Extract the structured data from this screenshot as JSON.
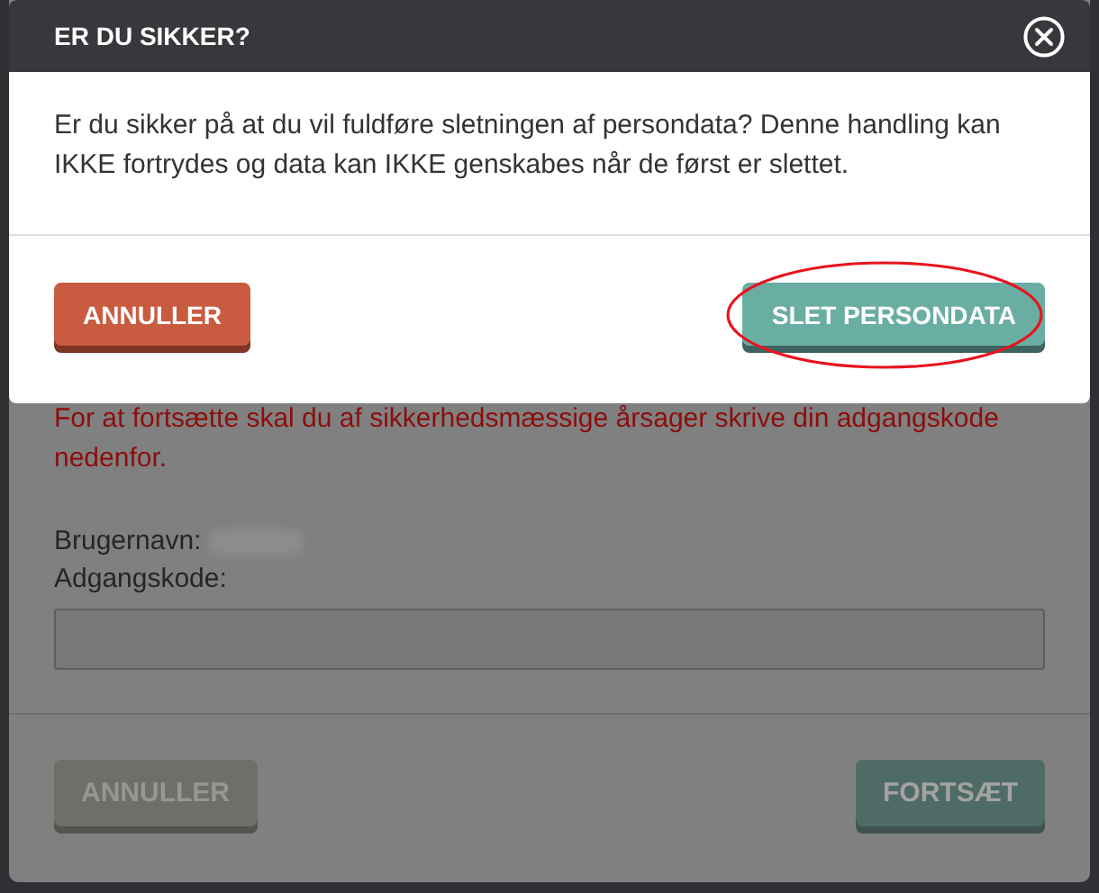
{
  "dialog": {
    "title": "ER DU SIKKER?",
    "message": "Er du sikker på at du vil fuldføre sletningen af persondata? Denne handling kan IKKE fortrydes og data kan IKKE genskabes når de først er slettet.",
    "buttons": [
      {
        "label": "ANNULLER",
        "kind": "cancel",
        "circled": false
      },
      {
        "label": "SLET PERSONDATA",
        "kind": "confirm",
        "circled": true
      }
    ]
  },
  "background_dialog": {
    "warning": "For at fortsætte skal du af sikkerhedsmæssige årsager skrive din adgangskode nedenfor.",
    "fields": [
      {
        "label": "Brugernavn:",
        "kind": "blurred"
      },
      {
        "label": "Adgangskode:",
        "kind": "input"
      }
    ],
    "buttons": [
      {
        "label": "ANNULLER",
        "kind": "cancel",
        "disabled": true
      },
      {
        "label": "FORTSÆT",
        "kind": "confirm",
        "disabled": false
      }
    ]
  }
}
